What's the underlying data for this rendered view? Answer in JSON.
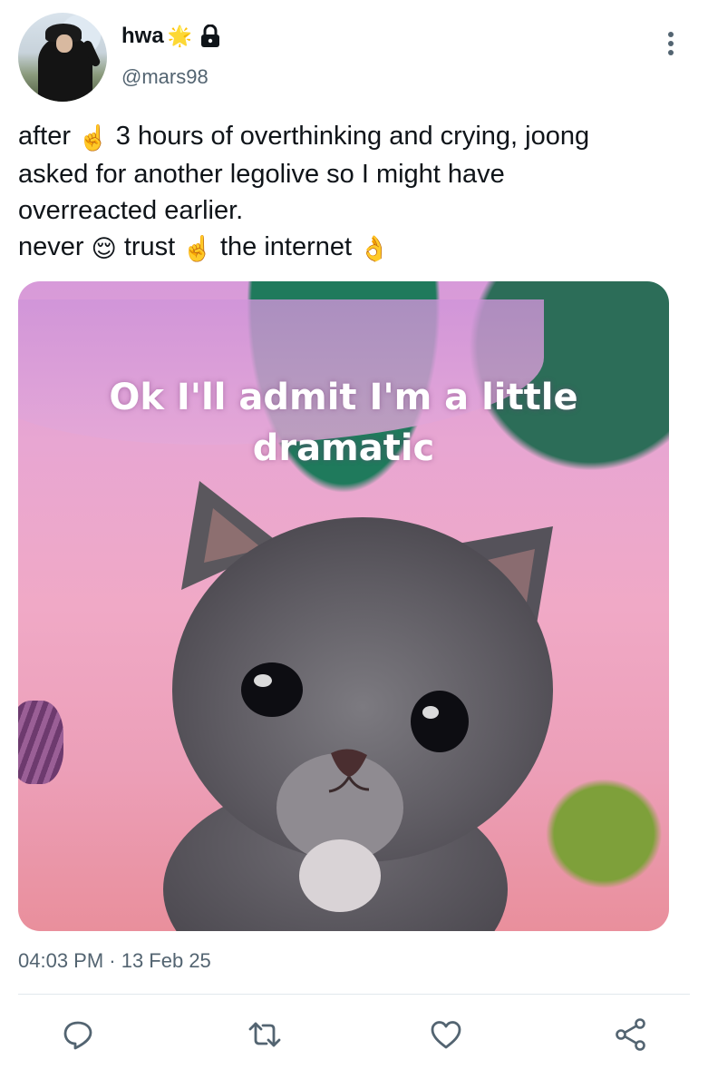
{
  "author": {
    "display_name": "hwa",
    "handle": "@mars98",
    "name_badge_icon": "sparkle-icon",
    "protected_icon": "lock-icon"
  },
  "tweet": {
    "lines": [
      {
        "parts": [
          {
            "t": "after "
          },
          {
            "emoji": "☝️"
          },
          {
            "t": " 3 hours of overthinking and crying, joong"
          }
        ]
      },
      {
        "parts": [
          {
            "t": "asked for another legolive so I might have"
          }
        ]
      },
      {
        "parts": [
          {
            "t": "overreacted earlier."
          }
        ]
      },
      {
        "parts": [
          {
            "t": "never "
          },
          {
            "emoji": "😌"
          },
          {
            "t": " trust "
          },
          {
            "emoji": "☝️"
          },
          {
            "t": " the internet "
          },
          {
            "emoji": "👌"
          }
        ]
      }
    ],
    "media_caption_line1": "Ok I'll admit I'm a little",
    "media_caption_line2": "dramatic",
    "timestamp": "04:03 PM · 13 Feb 25"
  },
  "actions": [
    "reply-icon",
    "retweet-icon",
    "like-icon",
    "share-icon"
  ],
  "colors": {
    "text": "#0f1419",
    "secondary": "#536471",
    "divider": "#e1e8ed",
    "icon": "#536471"
  }
}
